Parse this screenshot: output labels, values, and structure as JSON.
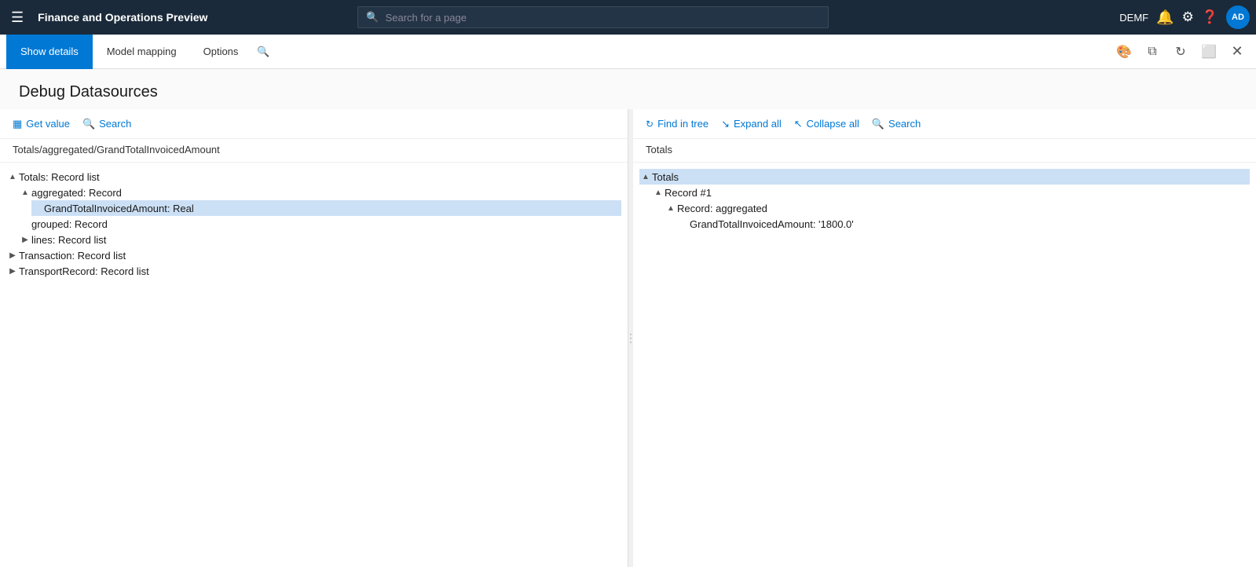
{
  "topbar": {
    "title": "Finance and Operations Preview",
    "search_placeholder": "Search for a page",
    "user_label": "DEMF",
    "user_initials": "AD"
  },
  "toolbar": {
    "tab_show_details": "Show details",
    "tab_model_mapping": "Model mapping",
    "tab_options": "Options"
  },
  "page": {
    "title": "Debug Datasources"
  },
  "left_pane": {
    "btn_get_value": "Get value",
    "btn_search": "Search",
    "path": "Totals/aggregated/GrandTotalInvoicedAmount",
    "tree": [
      {
        "id": "totals",
        "label": "Totals: Record list",
        "indent": 0,
        "state": "expanded"
      },
      {
        "id": "aggregated",
        "label": "aggregated: Record",
        "indent": 1,
        "state": "expanded"
      },
      {
        "id": "grandtotal",
        "label": "GrandTotalInvoicedAmount: Real",
        "indent": 2,
        "state": "leaf",
        "selected": true
      },
      {
        "id": "grouped",
        "label": "grouped: Record",
        "indent": 1,
        "state": "leaf"
      },
      {
        "id": "lines",
        "label": "lines: Record list",
        "indent": 1,
        "state": "collapsed"
      },
      {
        "id": "transaction",
        "label": "Transaction: Record list",
        "indent": 0,
        "state": "collapsed"
      },
      {
        "id": "transportrecord",
        "label": "TransportRecord: Record list",
        "indent": 0,
        "state": "collapsed"
      }
    ]
  },
  "right_pane": {
    "btn_find_in_tree": "Find in tree",
    "btn_expand_all": "Expand all",
    "btn_collapse_all": "Collapse all",
    "btn_search": "Search",
    "label": "Totals",
    "tree": [
      {
        "id": "rtotals",
        "label": "Totals",
        "indent": 0,
        "state": "expanded",
        "highlight": true
      },
      {
        "id": "rrecord1",
        "label": "Record #1",
        "indent": 1,
        "state": "expanded"
      },
      {
        "id": "raggregated",
        "label": "Record: aggregated",
        "indent": 2,
        "state": "expanded"
      },
      {
        "id": "rgrandtotal",
        "label": "GrandTotalInvoicedAmount: '1800.0'",
        "indent": 3,
        "state": "leaf"
      }
    ]
  }
}
